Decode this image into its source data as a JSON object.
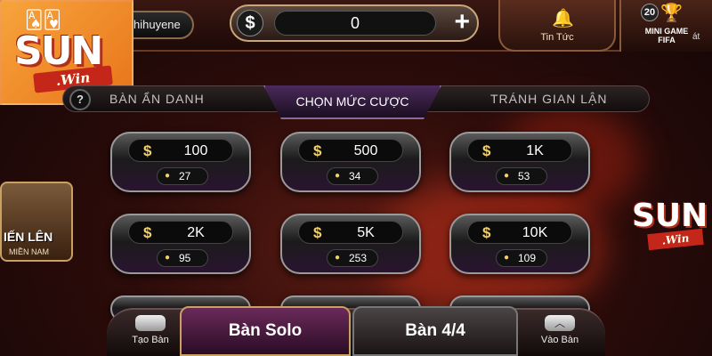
{
  "header": {
    "username": "hihuyene",
    "balance": "0",
    "currency_symbol": "$",
    "add_symbol": "+",
    "news_label": "Tin Tức",
    "mini_game_badge": "20",
    "mini_game_label": "MINI GAME FIFA",
    "mini_game_trailing": "át"
  },
  "logo": {
    "brand": "SUN",
    "sub": ".Win"
  },
  "tabs": {
    "help": "?",
    "left": "BÀN ẨN DANH",
    "center": "CHỌN MỨC CƯỢC",
    "right": "TRÁNH GIAN LẬN"
  },
  "bets": [
    {
      "amount": "100",
      "players": "27"
    },
    {
      "amount": "500",
      "players": "34"
    },
    {
      "amount": "1K",
      "players": "53"
    },
    {
      "amount": "2K",
      "players": "95"
    },
    {
      "amount": "5K",
      "players": "253"
    },
    {
      "amount": "10K",
      "players": "109"
    }
  ],
  "side_game": {
    "title": "IẾN LÊN",
    "subtitle": "MIỀN NAM"
  },
  "bottom": {
    "create_table": "Tạo Bàn",
    "solo": "Bàn Solo",
    "four": "Bàn 4/4",
    "join": "Vào Bàn"
  },
  "colors": {
    "accent_gold": "#f2d06a",
    "logo_orange": "#f7a43c",
    "logo_red": "#c4261a"
  }
}
